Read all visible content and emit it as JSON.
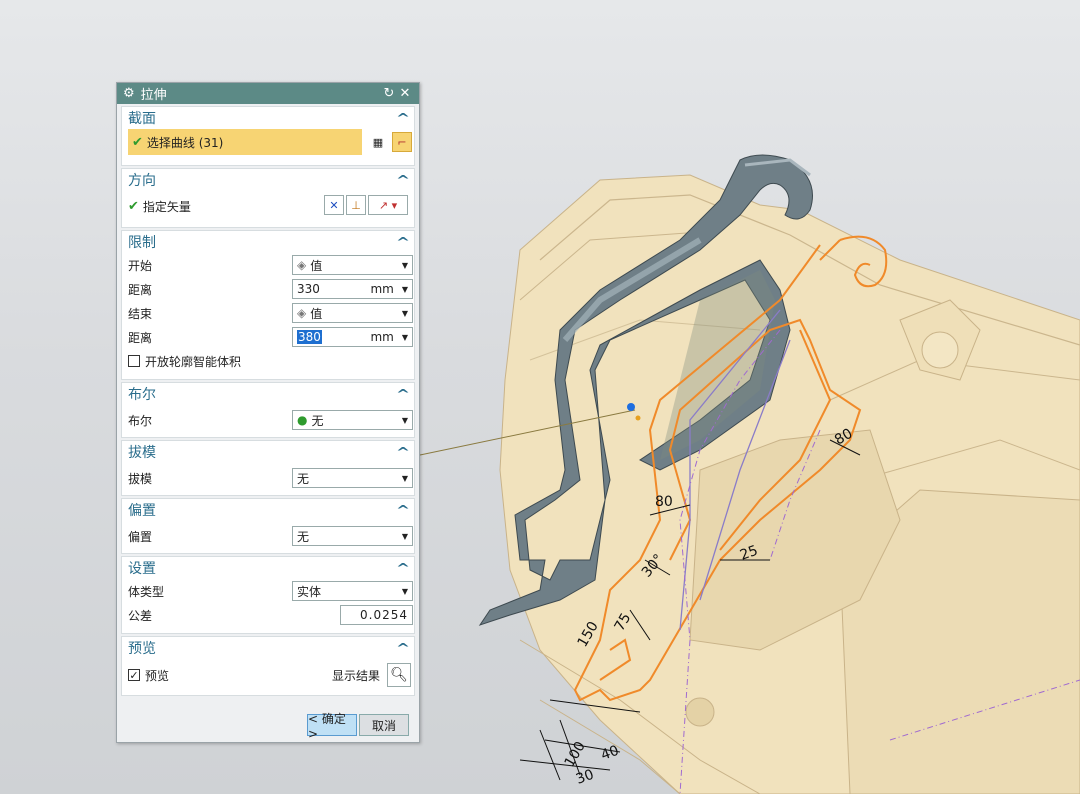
{
  "dialog": {
    "title": "拉伸",
    "sections": {
      "section": {
        "header": "截面",
        "select_curve_label": "选择曲线 (31)"
      },
      "direction": {
        "header": "方向",
        "vector_label": "指定矢量"
      },
      "limits": {
        "header": "限制",
        "start_label": "开始",
        "start_value": "值",
        "start_distance_label": "距离",
        "start_distance_value": "330",
        "start_unit": "mm",
        "end_label": "结束",
        "end_value": "值",
        "end_distance_label": "距离",
        "end_distance_value": "380",
        "end_unit": "mm",
        "open_profile_label": "开放轮廓智能体积"
      },
      "boolean": {
        "header": "布尔",
        "label": "布尔",
        "value": "无"
      },
      "draft": {
        "header": "拔模",
        "label": "拔模",
        "value": "无"
      },
      "offset": {
        "header": "偏置",
        "label": "偏置",
        "value": "无"
      },
      "settings": {
        "header": "设置",
        "body_type_label": "体类型",
        "body_type_value": "实体",
        "tolerance_label": "公差",
        "tolerance_value": "0.0254"
      },
      "preview": {
        "header": "预览",
        "preview_label": "预览",
        "show_result_label": "显示结果"
      }
    },
    "buttons": {
      "ok": "< 确定 >",
      "cancel": "取消"
    }
  },
  "dimensions": [
    "80",
    "80",
    "25",
    "30°",
    "150",
    "75",
    "40",
    "100",
    "30"
  ],
  "colors": {
    "titlebar": "#5c8a86",
    "section_header": "#2a6d8c",
    "selected_row": "#f7d473",
    "model_body": "#f2e3be",
    "extrusion": "#6f7e86",
    "sketch_curve": "#f08a2a"
  }
}
